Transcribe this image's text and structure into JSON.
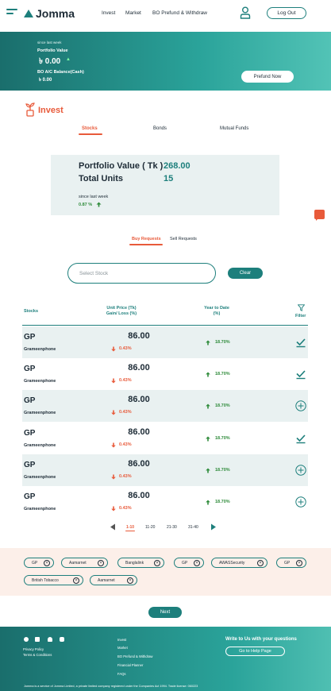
{
  "header": {
    "logo": "Jomma",
    "nav": [
      "Invest",
      "Market",
      "BO Prefund & Withdraw"
    ],
    "logout": "Log Out"
  },
  "banner": {
    "since": "since last week",
    "portfolio_label": "Portfolio Value",
    "portfolio_value": "৳ 0.00",
    "bo_label": "BO A/C Balance(Cash)",
    "bo_value": "৳ 0.00",
    "prefund": "Prefund Now"
  },
  "invest": {
    "title": "Invest",
    "tabs": [
      "Stocks",
      "Bonds",
      "Mutual Funds"
    ],
    "summary": {
      "portfolio_label": "Portfolio Value ( Tk )",
      "portfolio_value": "268.00",
      "units_label": "Total Units",
      "units_value": "15",
      "since": "since last week",
      "change": "0.87 %"
    },
    "request_tabs": [
      "Buy Requests",
      "Sell Requests"
    ],
    "search_placeholder": "Select Stock",
    "clear": "Clear"
  },
  "table": {
    "headers": {
      "stocks": "Stocks",
      "price": "Unit Price (Tk)",
      "gain": "Gain/ Loss (%)",
      "ytd": "Year to Date",
      "ytd_unit": "(%)",
      "filter": "Filter"
    },
    "rows": [
      {
        "symbol": "GP",
        "name": "Grameenphone",
        "price": "86.00",
        "loss": "0.43%",
        "ytd": "18.70%",
        "action": "check"
      },
      {
        "symbol": "GP",
        "name": "Grameenphone",
        "price": "86.00",
        "loss": "0.43%",
        "ytd": "18.70%",
        "action": "check"
      },
      {
        "symbol": "GP",
        "name": "Grameenphone",
        "price": "86.00",
        "loss": "0.43%",
        "ytd": "18.70%",
        "action": "add"
      },
      {
        "symbol": "GP",
        "name": "Grameenphone",
        "price": "86.00",
        "loss": "0.43%",
        "ytd": "18.70%",
        "action": "check"
      },
      {
        "symbol": "GP",
        "name": "Grameenphone",
        "price": "86.00",
        "loss": "0.43%",
        "ytd": "18.70%",
        "action": "add"
      },
      {
        "symbol": "GP",
        "name": "Grameenphone",
        "price": "86.00",
        "loss": "0.43%",
        "ytd": "18.70%",
        "action": "add"
      }
    ],
    "pages": [
      "1-10",
      "11-20",
      "21-30",
      "31-40"
    ]
  },
  "chips": [
    "GP",
    "Aamarnet",
    "Banglalink",
    "GP",
    "AWASSecurity",
    "GP",
    "British Tobacco",
    "Aamarnet"
  ],
  "next": "Next",
  "footer": {
    "links_left": [
      "Privacy Policy",
      "Terms & Conditions"
    ],
    "links_mid": [
      "Invest",
      "Market",
      "BO Prefund & Withdraw",
      "Financial Planner",
      "FAQs"
    ],
    "write_us": "Write to Us with your questions",
    "help": "Go to Help Page",
    "legal": "Jomma is a service of Jomma Limited, a private limited company registered under the Companies Act 1994. Trade license: 060223"
  },
  "colors": {
    "brand": "#1d7f7c",
    "accent": "#e85a3a",
    "up": "#2e8b3a"
  }
}
